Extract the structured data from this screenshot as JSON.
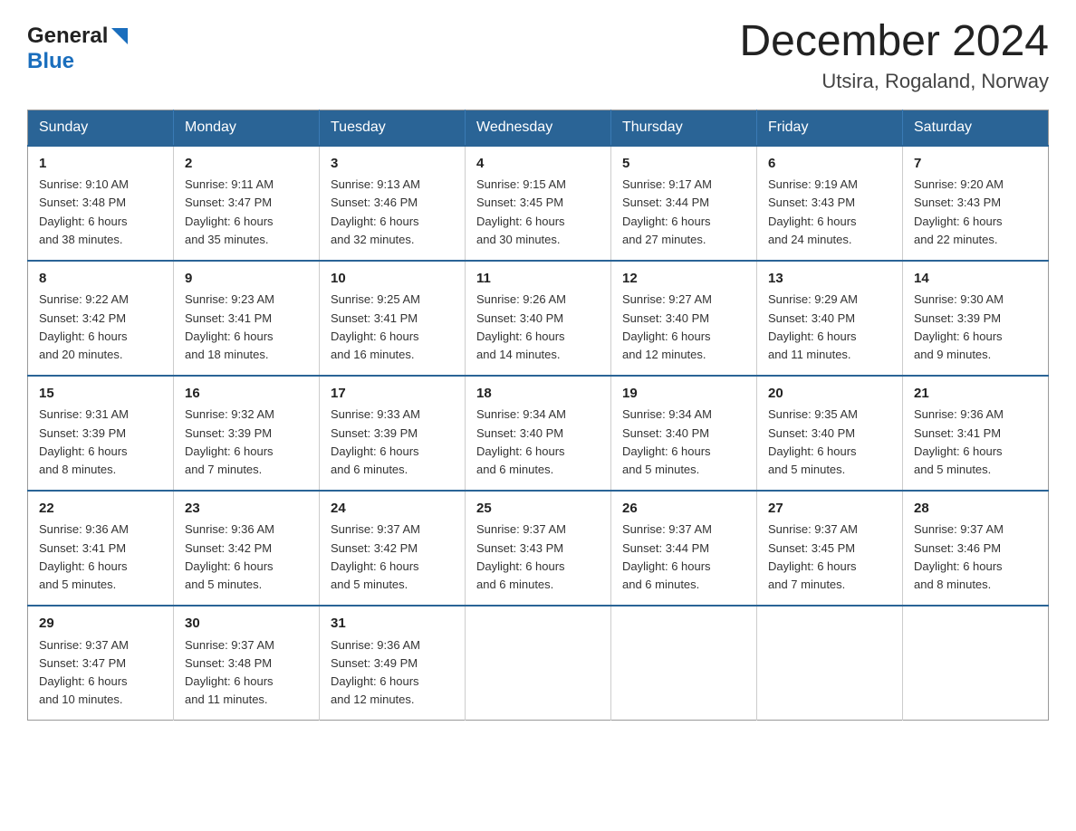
{
  "header": {
    "logo_general": "General",
    "logo_blue": "Blue",
    "month_title": "December 2024",
    "location": "Utsira, Rogaland, Norway"
  },
  "days_of_week": [
    "Sunday",
    "Monday",
    "Tuesday",
    "Wednesday",
    "Thursday",
    "Friday",
    "Saturday"
  ],
  "weeks": [
    [
      {
        "day": "1",
        "sunrise": "9:10 AM",
        "sunset": "3:48 PM",
        "daylight": "6 hours and 38 minutes."
      },
      {
        "day": "2",
        "sunrise": "9:11 AM",
        "sunset": "3:47 PM",
        "daylight": "6 hours and 35 minutes."
      },
      {
        "day": "3",
        "sunrise": "9:13 AM",
        "sunset": "3:46 PM",
        "daylight": "6 hours and 32 minutes."
      },
      {
        "day": "4",
        "sunrise": "9:15 AM",
        "sunset": "3:45 PM",
        "daylight": "6 hours and 30 minutes."
      },
      {
        "day": "5",
        "sunrise": "9:17 AM",
        "sunset": "3:44 PM",
        "daylight": "6 hours and 27 minutes."
      },
      {
        "day": "6",
        "sunrise": "9:19 AM",
        "sunset": "3:43 PM",
        "daylight": "6 hours and 24 minutes."
      },
      {
        "day": "7",
        "sunrise": "9:20 AM",
        "sunset": "3:43 PM",
        "daylight": "6 hours and 22 minutes."
      }
    ],
    [
      {
        "day": "8",
        "sunrise": "9:22 AM",
        "sunset": "3:42 PM",
        "daylight": "6 hours and 20 minutes."
      },
      {
        "day": "9",
        "sunrise": "9:23 AM",
        "sunset": "3:41 PM",
        "daylight": "6 hours and 18 minutes."
      },
      {
        "day": "10",
        "sunrise": "9:25 AM",
        "sunset": "3:41 PM",
        "daylight": "6 hours and 16 minutes."
      },
      {
        "day": "11",
        "sunrise": "9:26 AM",
        "sunset": "3:40 PM",
        "daylight": "6 hours and 14 minutes."
      },
      {
        "day": "12",
        "sunrise": "9:27 AM",
        "sunset": "3:40 PM",
        "daylight": "6 hours and 12 minutes."
      },
      {
        "day": "13",
        "sunrise": "9:29 AM",
        "sunset": "3:40 PM",
        "daylight": "6 hours and 11 minutes."
      },
      {
        "day": "14",
        "sunrise": "9:30 AM",
        "sunset": "3:39 PM",
        "daylight": "6 hours and 9 minutes."
      }
    ],
    [
      {
        "day": "15",
        "sunrise": "9:31 AM",
        "sunset": "3:39 PM",
        "daylight": "6 hours and 8 minutes."
      },
      {
        "day": "16",
        "sunrise": "9:32 AM",
        "sunset": "3:39 PM",
        "daylight": "6 hours and 7 minutes."
      },
      {
        "day": "17",
        "sunrise": "9:33 AM",
        "sunset": "3:39 PM",
        "daylight": "6 hours and 6 minutes."
      },
      {
        "day": "18",
        "sunrise": "9:34 AM",
        "sunset": "3:40 PM",
        "daylight": "6 hours and 6 minutes."
      },
      {
        "day": "19",
        "sunrise": "9:34 AM",
        "sunset": "3:40 PM",
        "daylight": "6 hours and 5 minutes."
      },
      {
        "day": "20",
        "sunrise": "9:35 AM",
        "sunset": "3:40 PM",
        "daylight": "6 hours and 5 minutes."
      },
      {
        "day": "21",
        "sunrise": "9:36 AM",
        "sunset": "3:41 PM",
        "daylight": "6 hours and 5 minutes."
      }
    ],
    [
      {
        "day": "22",
        "sunrise": "9:36 AM",
        "sunset": "3:41 PM",
        "daylight": "6 hours and 5 minutes."
      },
      {
        "day": "23",
        "sunrise": "9:36 AM",
        "sunset": "3:42 PM",
        "daylight": "6 hours and 5 minutes."
      },
      {
        "day": "24",
        "sunrise": "9:37 AM",
        "sunset": "3:42 PM",
        "daylight": "6 hours and 5 minutes."
      },
      {
        "day": "25",
        "sunrise": "9:37 AM",
        "sunset": "3:43 PM",
        "daylight": "6 hours and 6 minutes."
      },
      {
        "day": "26",
        "sunrise": "9:37 AM",
        "sunset": "3:44 PM",
        "daylight": "6 hours and 6 minutes."
      },
      {
        "day": "27",
        "sunrise": "9:37 AM",
        "sunset": "3:45 PM",
        "daylight": "6 hours and 7 minutes."
      },
      {
        "day": "28",
        "sunrise": "9:37 AM",
        "sunset": "3:46 PM",
        "daylight": "6 hours and 8 minutes."
      }
    ],
    [
      {
        "day": "29",
        "sunrise": "9:37 AM",
        "sunset": "3:47 PM",
        "daylight": "6 hours and 10 minutes."
      },
      {
        "day": "30",
        "sunrise": "9:37 AM",
        "sunset": "3:48 PM",
        "daylight": "6 hours and 11 minutes."
      },
      {
        "day": "31",
        "sunrise": "9:36 AM",
        "sunset": "3:49 PM",
        "daylight": "6 hours and 12 minutes."
      },
      null,
      null,
      null,
      null
    ]
  ],
  "labels": {
    "sunrise": "Sunrise:",
    "sunset": "Sunset:",
    "daylight": "Daylight:"
  }
}
